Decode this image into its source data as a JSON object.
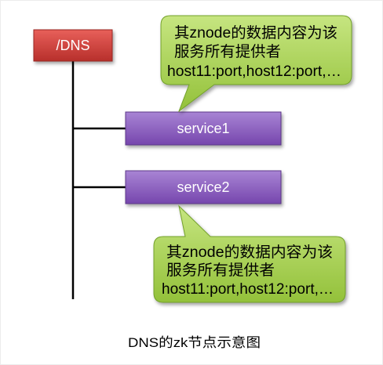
{
  "root": {
    "label": "/DNS"
  },
  "services": [
    {
      "label": "service1"
    },
    {
      "label": "service2"
    }
  ],
  "callouts": [
    {
      "lines": [
        "其znode的数据内容为该",
        "服务所有提供者",
        "host11:port,host12:port,…"
      ]
    },
    {
      "lines": [
        "其znode的数据内容为该",
        "服务所有提供者",
        "host11:port,host12:port,…"
      ]
    }
  ],
  "caption": "DNS的zk节点示意图",
  "colors": {
    "root_top": "#e8605a",
    "root_bottom": "#b72f2b",
    "root_border": "#9a2522",
    "service_top": "#a884d4",
    "service_bottom": "#7646ad",
    "service_border": "#5d3789",
    "callout_top": "#c6e580",
    "callout_bottom": "#93c13a",
    "callout_border": "#73a12c",
    "connector": "#000000"
  }
}
